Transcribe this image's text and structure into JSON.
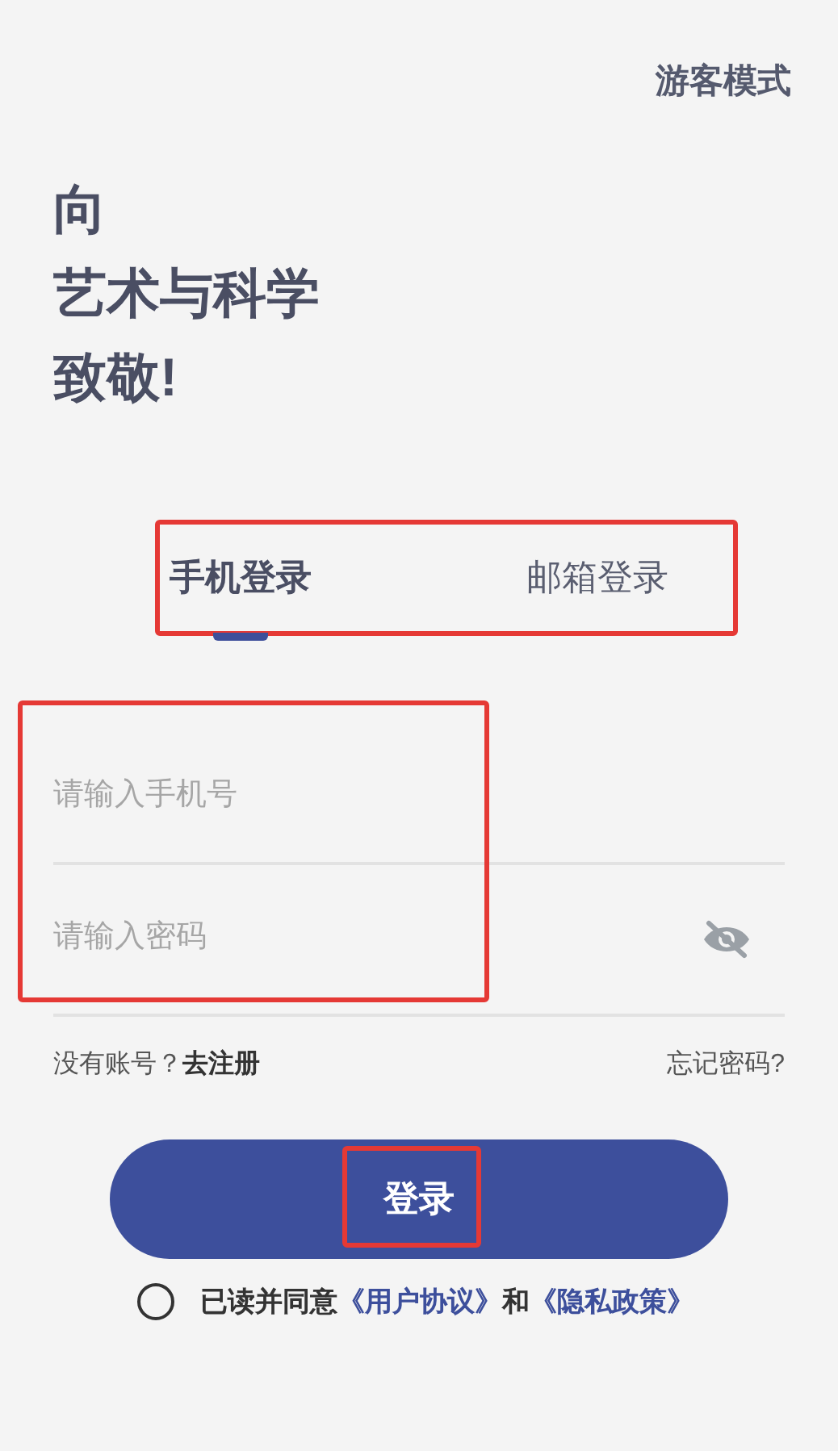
{
  "guest_mode": "游客模式",
  "heading_lines": [
    "向",
    "艺术与科学",
    "致敬!"
  ],
  "tabs_highlighted": true,
  "tabs": [
    {
      "label": "手机登录",
      "selected": true
    },
    {
      "label": "邮箱登录",
      "selected": false
    }
  ],
  "fields_highlighted": true,
  "phone_field": {
    "placeholder": "请输入手机号"
  },
  "password_field": {
    "placeholder": "请输入密码",
    "visible": false
  },
  "register_prompt": "没有账号？",
  "register_link": "去注册",
  "forgot_password": "忘记密码?",
  "login_button": {
    "label": "登录",
    "highlighted": true
  },
  "agreement": {
    "checked": false,
    "text": "已读并同意",
    "user_agreement": "《用户协议》",
    "and": "和",
    "privacy_policy": "《隐私政策》"
  }
}
